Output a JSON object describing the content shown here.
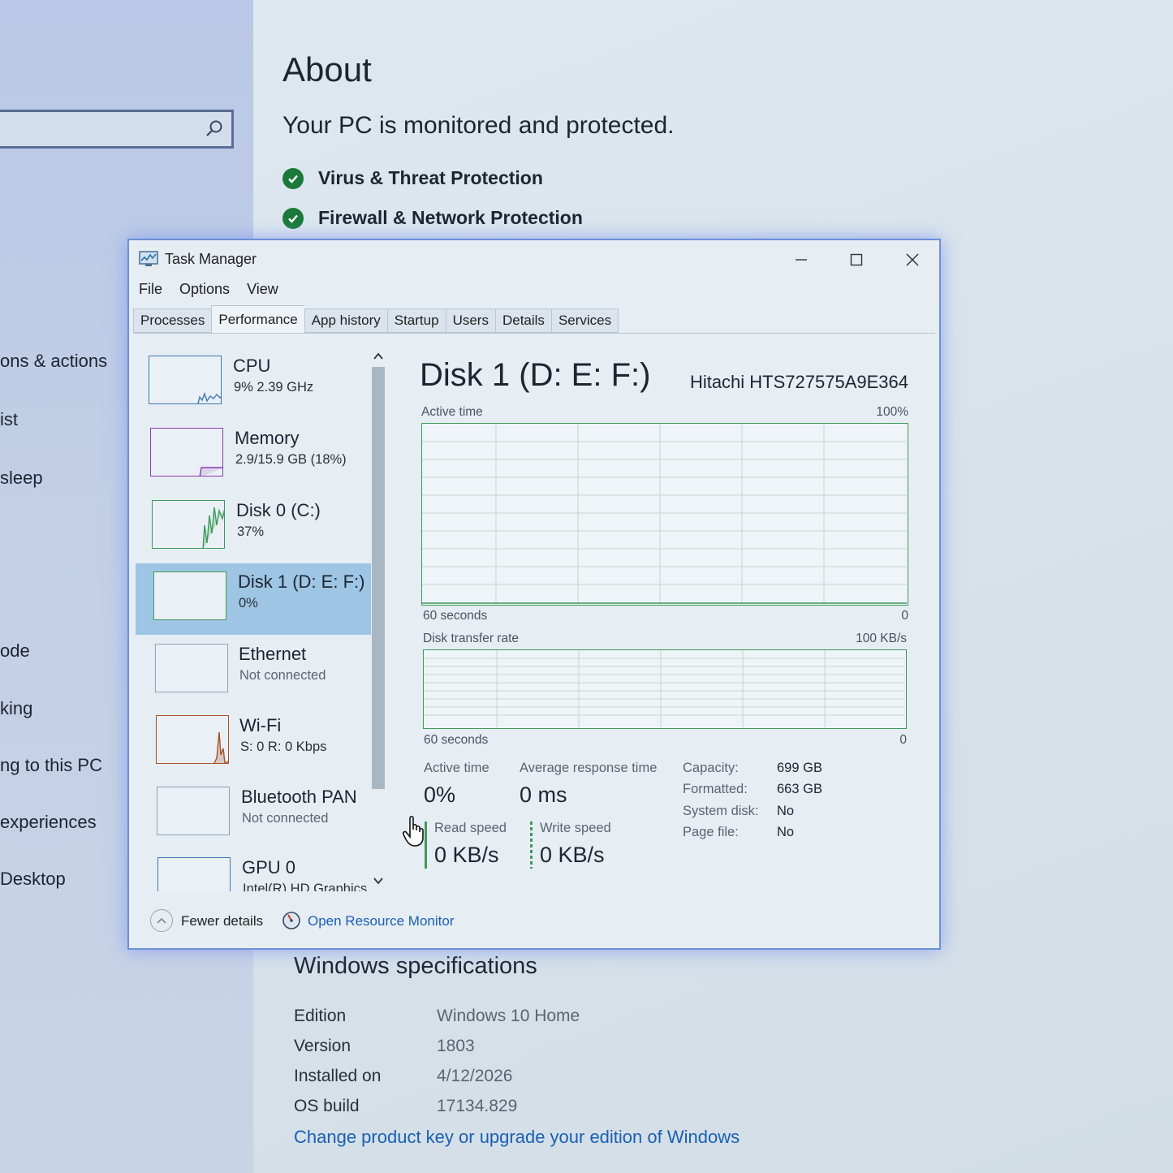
{
  "settings": {
    "search": {
      "value": "",
      "placeholder": ""
    },
    "nav_items": [
      "ons & actions",
      "ist",
      "sleep",
      "ode",
      "king",
      "ng to this PC",
      "experiences",
      " Desktop"
    ],
    "about_title": "About",
    "protection_status": "Your PC is monitored and protected.",
    "protections": [
      {
        "label": "Virus & Threat Protection",
        "icon": "check-circle-icon"
      },
      {
        "label": "Firewall & Network Protection",
        "icon": "check-circle-icon"
      }
    ],
    "windows_spec": {
      "title": "Windows specifications",
      "rows": [
        {
          "label": "Edition",
          "value": "Windows 10 Home"
        },
        {
          "label": "Version",
          "value": "1803"
        },
        {
          "label": "Installed on",
          "value": "4/12/2026"
        },
        {
          "label": "OS build",
          "value": "17134.829"
        }
      ],
      "link": "Change product key or upgrade your edition of Windows"
    }
  },
  "task_manager": {
    "title": "Task Manager",
    "menu": [
      "File",
      "Options",
      "View"
    ],
    "tabs": [
      "Processes",
      "Performance",
      "App history",
      "Startup",
      "Users",
      "Details",
      "Services"
    ],
    "active_tab": "Performance",
    "devices": [
      {
        "name": "CPU",
        "sub": "9%  2.39 GHz",
        "sub_grey": false,
        "selected": false
      },
      {
        "name": "Memory",
        "sub": "2.9/15.9 GB (18%)",
        "sub_grey": false,
        "selected": false
      },
      {
        "name": "Disk 0 (C:)",
        "sub": "37%",
        "sub_grey": false,
        "selected": false
      },
      {
        "name": "Disk 1 (D: E: F:)",
        "sub": "0%",
        "sub_grey": false,
        "selected": true
      },
      {
        "name": "Ethernet",
        "sub": "Not connected",
        "sub_grey": true,
        "selected": false
      },
      {
        "name": "Wi-Fi",
        "sub": "S: 0 R: 0 Kbps",
        "sub_grey": false,
        "selected": false
      },
      {
        "name": "Bluetooth PAN",
        "sub": "Not connected",
        "sub_grey": true,
        "selected": false
      },
      {
        "name": "GPU 0",
        "sub": "Intel(R) HD Graphics",
        "sub_grey": false,
        "selected": false
      }
    ],
    "detail": {
      "title": "Disk 1 (D: E: F:)",
      "model": "Hitachi HTS727575A9E364",
      "chart1": {
        "label": "Active time",
        "max": "100%",
        "time": "60 seconds",
        "min": "0"
      },
      "chart2": {
        "label": "Disk transfer rate",
        "max": "100 KB/s",
        "time": "60 seconds",
        "min": "0"
      },
      "stats": {
        "active_time_label": "Active time",
        "active_time_value": "0%",
        "avg_resp_label": "Average response time",
        "avg_resp_value": "0 ms",
        "read_label": "Read speed",
        "read_value": "0 KB/s",
        "write_label": "Write speed",
        "write_value": "0 KB/s"
      },
      "properties": [
        {
          "label": "Capacity:",
          "value": "699 GB"
        },
        {
          "label": "Formatted:",
          "value": "663 GB"
        },
        {
          "label": "System disk:",
          "value": "No"
        },
        {
          "label": "Page file:",
          "value": "No"
        }
      ]
    },
    "footer": {
      "fewer_details": "Fewer details",
      "resource_monitor": "Open Resource Monitor"
    },
    "colors": {
      "disk_green": "#3e9a5a",
      "selected_bg": "#9fc5e4",
      "cpu_blue": "#3d78b5",
      "memory_purple": "#8a3db0",
      "wifi_brown": "#a5522a",
      "link_blue": "#1a5fb4"
    }
  }
}
